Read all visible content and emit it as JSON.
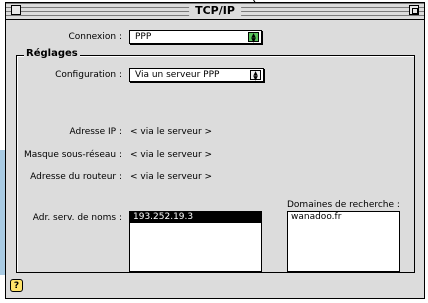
{
  "window": {
    "title": "TCP/IP"
  },
  "connexion": {
    "label": "Connexion :",
    "value": "PPP"
  },
  "settings": {
    "group_title": "Réglages",
    "configuration": {
      "label": "Configuration :",
      "value": "Via un serveur PPP"
    },
    "ip_address": {
      "label": "Adresse IP :",
      "value": "< via le serveur >"
    },
    "subnet_mask": {
      "label": "Masque sous-réseau :",
      "value": "< via le serveur >"
    },
    "router_address": {
      "label": "Adresse du routeur :",
      "value": "< via le serveur >"
    },
    "name_servers": {
      "label": "Adr. serv. de noms :",
      "entries": [
        "193.252.19.3"
      ]
    },
    "search_domains": {
      "label": "Domaines de recherche :",
      "entries": [
        "wanadoo.fr"
      ]
    }
  },
  "help": {
    "label": "?"
  },
  "colors": {
    "window_bg": "#dcdcdc",
    "selection_bg": "#000000",
    "popup_arrow_highlight": "#59c25b"
  }
}
